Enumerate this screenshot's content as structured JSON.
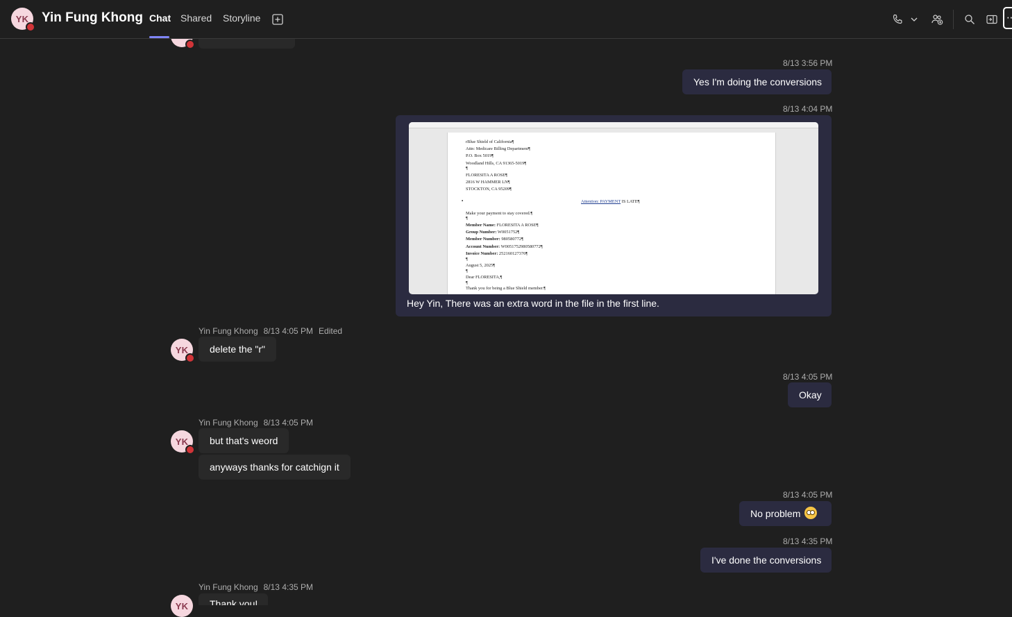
{
  "header": {
    "avatar_initials": "YK",
    "title": "Yin Fung Khong",
    "tabs": [
      "Chat",
      "Shared",
      "Storyline"
    ],
    "active_tab": "Chat"
  },
  "messages": {
    "m1": {
      "time": "8/13 3:56 PM",
      "text": "Yes I'm doing the conversions"
    },
    "m2": {
      "time": "8/13 4:04 PM",
      "caption": "Hey Yin, There was an extra word in the file in the first line."
    },
    "m3": {
      "sender": "Yin Fung Khong",
      "time": "8/13 4:05 PM",
      "edited": "Edited",
      "text": "delete the \"r\""
    },
    "m4": {
      "time": "8/13 4:05 PM",
      "text": "Okay"
    },
    "m5": {
      "sender": "Yin Fung Khong",
      "time": "8/13 4:05 PM",
      "text1": "but that's weord",
      "text2": "anyways thanks for catchign it"
    },
    "m6": {
      "time": "8/13 4:05 PM",
      "text": "No problem"
    },
    "m7": {
      "time": "8/13 4:35 PM",
      "text": "I've done the conversions"
    },
    "m8": {
      "sender": "Yin Fung Khong",
      "time": "8/13 4:35 PM",
      "text": "Thank you!"
    }
  },
  "document": {
    "lines": [
      "rBlue Shield of California¶",
      "Attn: Medicare Billing Department¶",
      "P.O. Box 5019¶",
      "Woodland Hills, CA 91365-5019¶",
      "¶",
      "FLORESITA A ROSE¶",
      "2816 W HAMMER LN¶",
      "STOCKTON, CA 95209¶"
    ],
    "attention": "Attention: PAYMENT",
    "attention_rest": " IS LATE¶",
    "lines2": [
      "Make your payment to stay covered.¶",
      "¶"
    ],
    "fields": [
      {
        "label": "Member Name:",
        "value": " FLORESITA A ROSE¶"
      },
      {
        "label": "Group Number:",
        "value": " W0051752¶"
      },
      {
        "label": "Member Number:",
        "value": " 980580772¶"
      },
      {
        "label": "Account Number:",
        "value": " W0051752980580772¶"
      },
      {
        "label": "Invoice Number:",
        "value": " 252160127376¶"
      }
    ],
    "lines3": [
      "¶",
      "August 5, 2025¶",
      "¶",
      "Dear FLORESITA,¶",
      "¶",
      "Thank you for being a Blue Shield member.¶"
    ]
  }
}
